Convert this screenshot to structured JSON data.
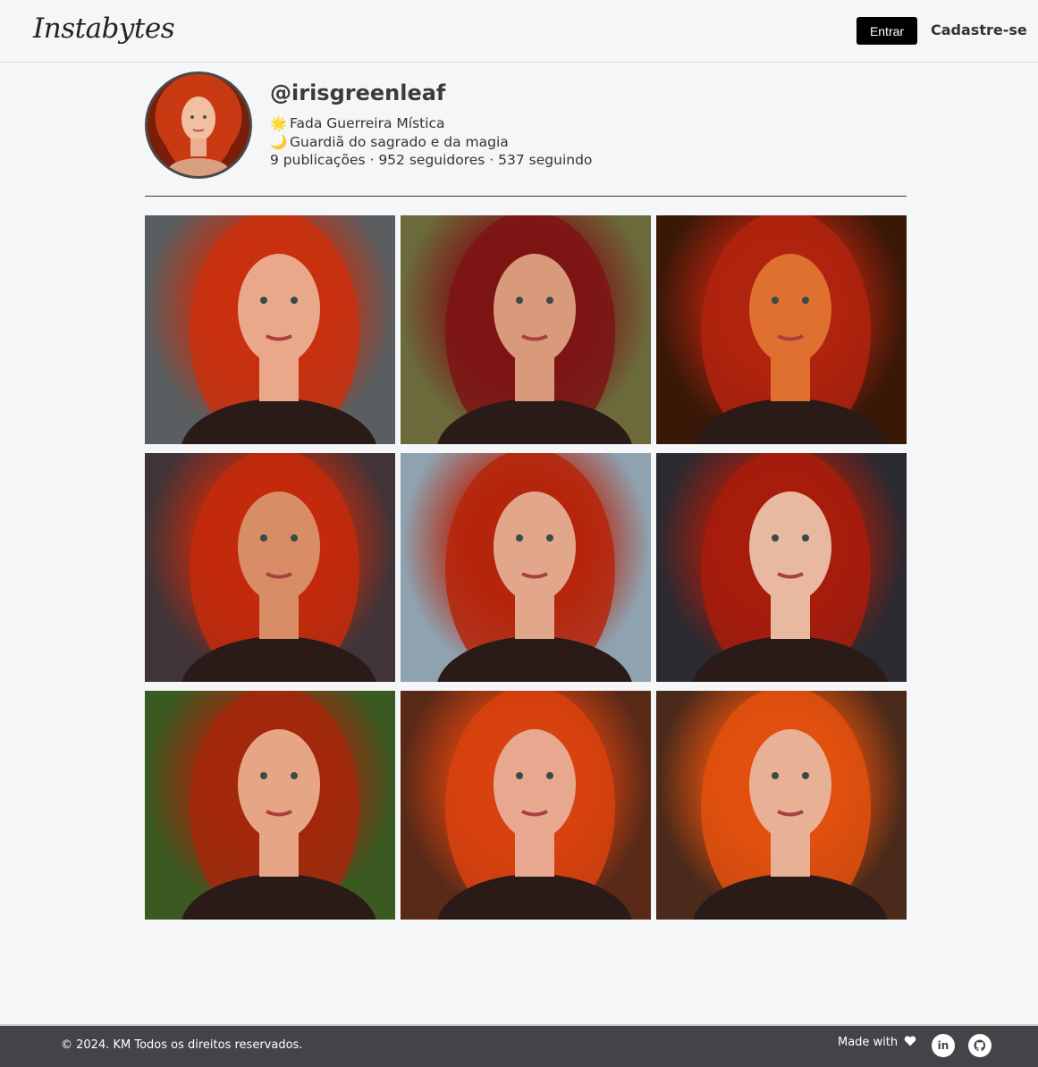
{
  "header": {
    "logo": "Instabytes",
    "login_label": "Entrar",
    "signup_label": "Cadastre-se"
  },
  "profile": {
    "username": "@irisgreenleaf",
    "bio": [
      {
        "icon": "sparkle-icon",
        "emoji": "🌟",
        "text": "Fada Guerreira Mística"
      },
      {
        "icon": "moon-icon",
        "emoji": "🌙",
        "text": "Guardiã do sagrado e da magia"
      }
    ],
    "stats": "9 publicações · 952 seguidores · 537 seguindo"
  },
  "posts": [
    {
      "bg": "#5a5e60",
      "hair": "#c8300e",
      "skin": "#e9a889"
    },
    {
      "bg": "#6b6a3a",
      "hair": "#7d1414",
      "skin": "#d89a7a"
    },
    {
      "bg": "#3a1808",
      "hair": "#b0230e",
      "skin": "#e07030"
    },
    {
      "bg": "#403438",
      "hair": "#c32a0c",
      "skin": "#d88d66"
    },
    {
      "bg": "#8ea2b0",
      "hair": "#b5260c",
      "skin": "#e2a68a"
    },
    {
      "bg": "#2a2a30",
      "hair": "#a81c0c",
      "skin": "#e8b8a0"
    },
    {
      "bg": "#3a5a22",
      "hair": "#a3280c",
      "skin": "#e6a584"
    },
    {
      "bg": "#5a2a18",
      "hair": "#d8420e",
      "skin": "#e8a890"
    },
    {
      "bg": "#4a2a1a",
      "hair": "#e0500e",
      "skin": "#e8b094"
    }
  ],
  "footer": {
    "copyright": "© 2024. KM Todos os direitos reservados.",
    "made_with": "Made with"
  }
}
